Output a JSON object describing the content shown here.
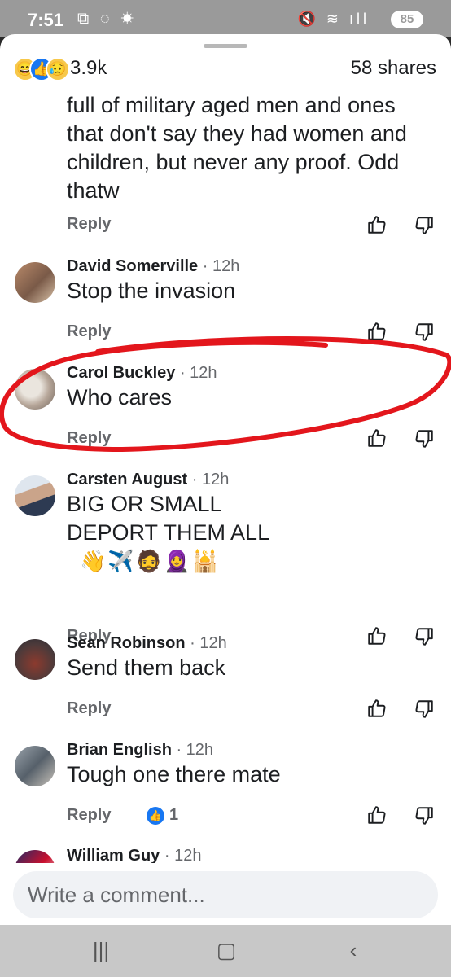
{
  "status": {
    "time": "7:51",
    "battery": "85"
  },
  "header": {
    "reaction_count": "3.9k",
    "shares": "58 shares"
  },
  "truncated_comment": {
    "text": "full of military aged men and ones that don't say they had women and children, but never any proof.  Odd thatw",
    "reply_label": "Reply"
  },
  "comments": [
    {
      "author": "David Somerville",
      "time": "· 12h",
      "text": "Stop the invasion",
      "reply_label": "Reply"
    },
    {
      "author": "Carol Buckley",
      "time": "· 12h",
      "text": "Who cares",
      "reply_label": "Reply"
    },
    {
      "author": "Carsten August",
      "time": "· 12h",
      "text_line1": "BIG OR SMALL",
      "text_line2": "DEPORT THEM ALL",
      "emojis": "👋✈️🧔🧕🕌",
      "reply_label": "Reply"
    },
    {
      "author": "Sean Robinson",
      "time": "· 12h",
      "text": "Send them back",
      "reply_label": "Reply"
    },
    {
      "author": "Brian English",
      "time": "· 12h",
      "text": "Tough one there mate",
      "reply_label": "Reply",
      "likes": "1"
    },
    {
      "author": "William Guy",
      "time": "· 12h"
    }
  ],
  "composer": {
    "placeholder": "Write a comment..."
  },
  "colors": {
    "annotation_red": "#e3161c",
    "accent_blue": "#1877f2"
  }
}
